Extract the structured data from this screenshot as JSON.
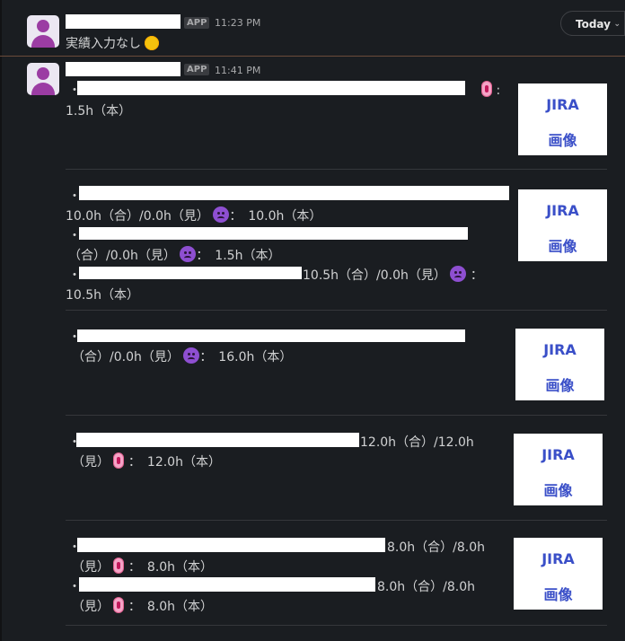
{
  "today_button": {
    "label": "Today",
    "chevron": "chevron-down-icon"
  },
  "messages": [
    {
      "badge": "APP",
      "time": "11:23 PM",
      "text": "実績入力なし",
      "emoji": "sun-emoji"
    },
    {
      "badge": "APP",
      "time": "11:41 PM"
    }
  ],
  "items": {
    "b1": {
      "colon": ":",
      "line2": "1.5h（本）"
    },
    "b2": {
      "line2_a": "10.0h（合）/0.0h（見）",
      "line2_b": "：　10.0h（本）"
    },
    "b3": {
      "line2_a": "（合）/0.0h（見）",
      "line2_b": "：　1.5h（本）"
    },
    "b4": {
      "tail": "10.5h（合）/0.0h（見）",
      "colon": "：",
      "line2": "10.5h（本）"
    },
    "b5": {
      "line2_a": "（合）/0.0h（見）",
      "line2_b": "：　16.0h（本）"
    },
    "b6": {
      "tail": "12.0h（合）/12.0h",
      "line2_a": "（見）",
      "line2_b": "：　12.0h（本）"
    },
    "b7": {
      "tail": "8.0h（合）/8.0h",
      "line2_a": "（見）",
      "line2_b": "：　8.0h（本）"
    },
    "b8": {
      "tail": "8.0h（合）/8.0h",
      "line2_a": "（見）",
      "line2_b": "：　8.0h（本）"
    }
  },
  "bullet": "・",
  "jira": {
    "line1": "JIRA",
    "line2": "画像"
  }
}
